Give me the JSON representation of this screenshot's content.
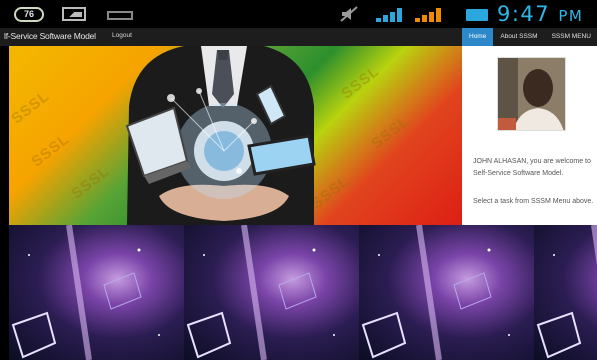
{
  "status_bar": {
    "battery_badge": "76",
    "time": "9:47",
    "ampm": "PM",
    "icons": [
      "battery-badge-icon",
      "image-notification-icon",
      "keyboard-icon",
      "mute-icon",
      "signal-icon",
      "battery-icon"
    ]
  },
  "navbar": {
    "brand": "lf-Service Software Model",
    "logout": "Logout",
    "tabs": [
      {
        "label": "Home",
        "active": true
      },
      {
        "label": "About SSSM",
        "active": false
      },
      {
        "label": "SSSM MENU",
        "active": false
      }
    ]
  },
  "hero": {
    "watermark": "SSSL"
  },
  "panel": {
    "welcome": "JOHN ALHASAN, you are welcome to Self-Service Software Model.",
    "instruction": "Select a task from SSSM Menu above."
  },
  "colors": {
    "nav_active": "#2c88c8",
    "clock": "#2fb6e8",
    "navbar_bg": "#1d1d1d"
  }
}
